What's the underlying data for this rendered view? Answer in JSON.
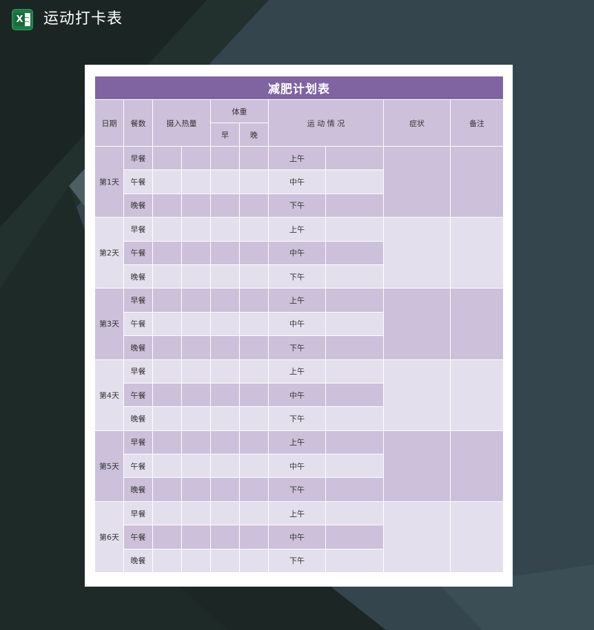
{
  "app": {
    "title": "运动打卡表",
    "icon": "excel-icon",
    "icon_letter": "X"
  },
  "colors": {
    "title_bar": "#8064a2",
    "header": "#ccc0da",
    "dark_fill": "#ccc0da",
    "light_fill": "#e4dfec",
    "background": "#2c3a40"
  },
  "sheet": {
    "title": "减肥计划表",
    "headers": {
      "date": "日期",
      "meals": "餐数",
      "calories": "摄入热量",
      "weight": "体重",
      "weight_morning": "早",
      "weight_evening": "晚",
      "exercise": "运 动 情 况",
      "symptoms": "症状",
      "notes": "备注"
    },
    "days": [
      {
        "label": "第1天",
        "meals": [
          "早餐",
          "午餐",
          "晚餐"
        ],
        "periods": [
          "上午",
          "中午",
          "下午"
        ]
      },
      {
        "label": "第2天",
        "meals": [
          "早餐",
          "午餐",
          "晚餐"
        ],
        "periods": [
          "上午",
          "中午",
          "下午"
        ]
      },
      {
        "label": "第3天",
        "meals": [
          "早餐",
          "午餐",
          "晚餐"
        ],
        "periods": [
          "上午",
          "中午",
          "下午"
        ]
      },
      {
        "label": "第4天",
        "meals": [
          "早餐",
          "午餐",
          "晚餐"
        ],
        "periods": [
          "上午",
          "中午",
          "下午"
        ]
      },
      {
        "label": "第5天",
        "meals": [
          "早餐",
          "午餐",
          "晚餐"
        ],
        "periods": [
          "上午",
          "中午",
          "下午"
        ]
      },
      {
        "label": "第6天",
        "meals": [
          "早餐",
          "午餐",
          "晚餐"
        ],
        "periods": [
          "上午",
          "中午",
          "下午"
        ]
      }
    ]
  }
}
